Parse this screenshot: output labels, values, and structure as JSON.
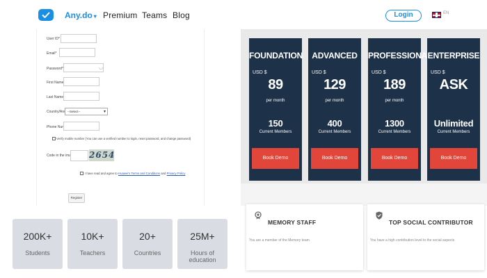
{
  "nav": {
    "brand": "Any.do",
    "brand_caret": "▾",
    "links": [
      "Premium",
      "Teams",
      "Blog"
    ],
    "login": "Login",
    "lang": "EN"
  },
  "form": {
    "fields": {
      "user_id": "User ID",
      "email": "Email",
      "password": "Password",
      "first_name": "First Name",
      "last_name": "Last Name",
      "country": "Country/Area",
      "phone": "Phone Number",
      "code": "Code in the image"
    },
    "required_mark": "*",
    "country_select": "--Select--",
    "verify_text": "Verify mobile number (You can use a verified number to login, reset password, and change password)",
    "captcha_text": "2654",
    "agree_prefix": "I have read and agree to",
    "agree_terms": "Huawei's Terms and Conditions",
    "agree_and": "and",
    "agree_privacy": "Privacy Policy",
    "register": "Register"
  },
  "plans": [
    {
      "name": "FOUNDATION",
      "currency": "USD $",
      "price": "89",
      "period": "per month",
      "members": "150",
      "members_label": "Current Members",
      "button": "Book Demo"
    },
    {
      "name": "ADVANCED",
      "currency": "USD $",
      "price": "129",
      "period": "per month",
      "members": "400",
      "members_label": "Current Members",
      "button": "Book Demo"
    },
    {
      "name": "PROFESSIONAL",
      "currency": "USD $",
      "price": "189",
      "period": "per month",
      "members": "1300",
      "members_label": "Current Members",
      "button": "Book Demo"
    },
    {
      "name": "ENTERPRISE",
      "currency": "USD $",
      "price": "ASK",
      "period": "",
      "members": "Unlimited",
      "members_label": "Current Members",
      "button": "Book Demo"
    }
  ],
  "stats": [
    {
      "value": "200K+",
      "label": "Students"
    },
    {
      "value": "10K+",
      "label": "Teachers"
    },
    {
      "value": "20+",
      "label": "Countries"
    },
    {
      "value": "25M+",
      "label": "Hours of education"
    }
  ],
  "achievements": [
    {
      "icon": "medal-icon",
      "title": "MEMORY STAFF",
      "desc": "You are a member of the Memory team"
    },
    {
      "icon": "shield-check-icon",
      "title": "TOP SOCIAL CONTRIBUTOR",
      "desc": "You have a high contribution level to the social aspects"
    }
  ],
  "colors": {
    "brand": "#1a8fe3",
    "plan_bg": "#1d3248",
    "plan_button": "#e2453a",
    "stat_bg": "#d9dce3"
  }
}
